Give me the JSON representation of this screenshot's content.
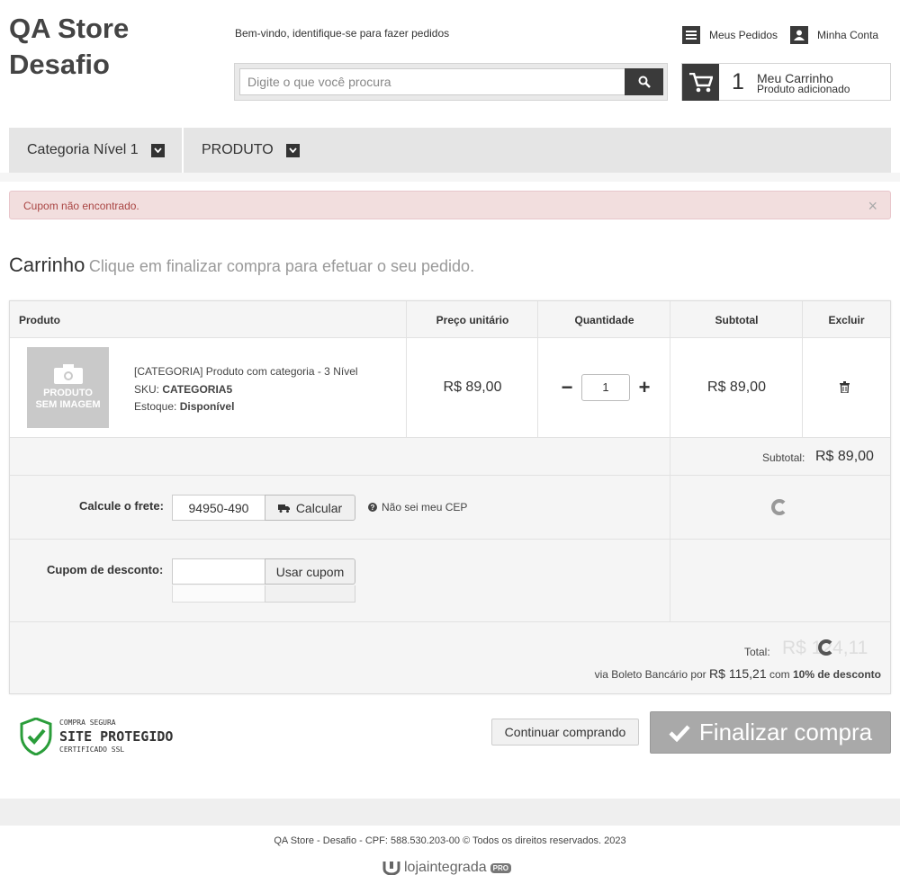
{
  "header": {
    "logo_line1": "QA Store",
    "logo_line2": "Desafio",
    "welcome": "Bem-vindo, identifique-se para fazer pedidos",
    "search_placeholder": "Digite o que você procura",
    "my_orders": "Meus Pedidos",
    "my_account": "Minha Conta",
    "cart_count": "1",
    "cart_title": "Meu Carrinho",
    "cart_status": "Produto adicionado"
  },
  "nav": {
    "items": [
      {
        "label": "Categoria Nível 1"
      },
      {
        "label": "PRODUTO"
      }
    ]
  },
  "alert": {
    "message": "Cupom não encontrado.",
    "close": "×",
    "color": "#a94442"
  },
  "page": {
    "title": "Carrinho",
    "subtitle": "Clique em finalizar compra para efetuar o seu pedido."
  },
  "table": {
    "columns": [
      "Produto",
      "Preço unitário",
      "Quantidade",
      "Subtotal",
      "Excluir"
    ],
    "item": {
      "image_text_1": "PRODUTO",
      "image_text_2": "SEM IMAGEM",
      "name": "[CATEGORIA] Produto com categoria - 3 Nível",
      "sku_label": "SKU:",
      "sku": "CATEGORIA5",
      "stock_label": "Estoque:",
      "stock": "Disponível",
      "unit_price": "R$ 89,00",
      "quantity": "1",
      "minus": "−",
      "plus": "+",
      "subtotal": "R$ 89,00"
    }
  },
  "summary": {
    "subtotal_label": "Subtotal:",
    "subtotal_value": "R$ 89,00",
    "shipping_label": "Calcule o frete:",
    "cep_value": "94950-490",
    "calc_button": "Calcular",
    "cep_help": "Não sei meu CEP",
    "coupon_label": "Cupom de desconto:",
    "coupon_value": "",
    "coupon_button": "Usar cupom",
    "total_label": "Total:",
    "total_value": "R$ 124,11",
    "boleto_prefix": "via Boleto Bancário por",
    "boleto_value": "R$ 115,21",
    "boleto_with": "com",
    "boleto_discount": "10% de desconto"
  },
  "seal": {
    "line1": "COMPRA SEGURA",
    "line2": "SITE PROTEGIDO",
    "line3": "CERTIFICADO SSL",
    "color": "#2a9d3a"
  },
  "actions": {
    "continue": "Continuar comprando",
    "finish": "Finalizar compra"
  },
  "footer": {
    "copyright": "QA Store - Desafio - CPF: 588.530.203-00 © Todos os direitos reservados. 2023",
    "brand": "lojaintegrada",
    "brand_badge": "PRO"
  }
}
